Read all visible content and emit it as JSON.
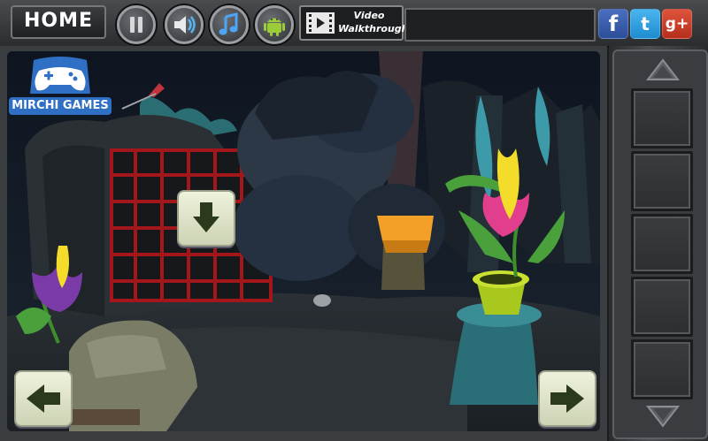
{
  "topbar": {
    "home_label": "HOME",
    "pause_icon": "pause-icon",
    "sound_icon": "speaker-icon",
    "music_icon": "music-note-icon",
    "android_icon": "android-icon",
    "video_line1": "Video",
    "video_line2": "Walkthrough"
  },
  "social": {
    "facebook": "f",
    "twitter": "t",
    "googleplus": "g+"
  },
  "logo": {
    "label": "MIRCHI GAMES"
  },
  "scene": {
    "nav_down": "arrow-down-icon",
    "nav_left": "arrow-left-icon",
    "nav_right": "arrow-right-icon"
  },
  "inventory": {
    "slots": [
      "",
      "",
      "",
      "",
      ""
    ],
    "scroll_up": "triangle-up-icon",
    "scroll_down": "triangle-down-icon"
  },
  "colors": {
    "accent_blue": "#2f6fc4",
    "button_cream": "#e6ebd2",
    "cage_red": "#a3161a",
    "pot_green": "#a8c81e"
  }
}
